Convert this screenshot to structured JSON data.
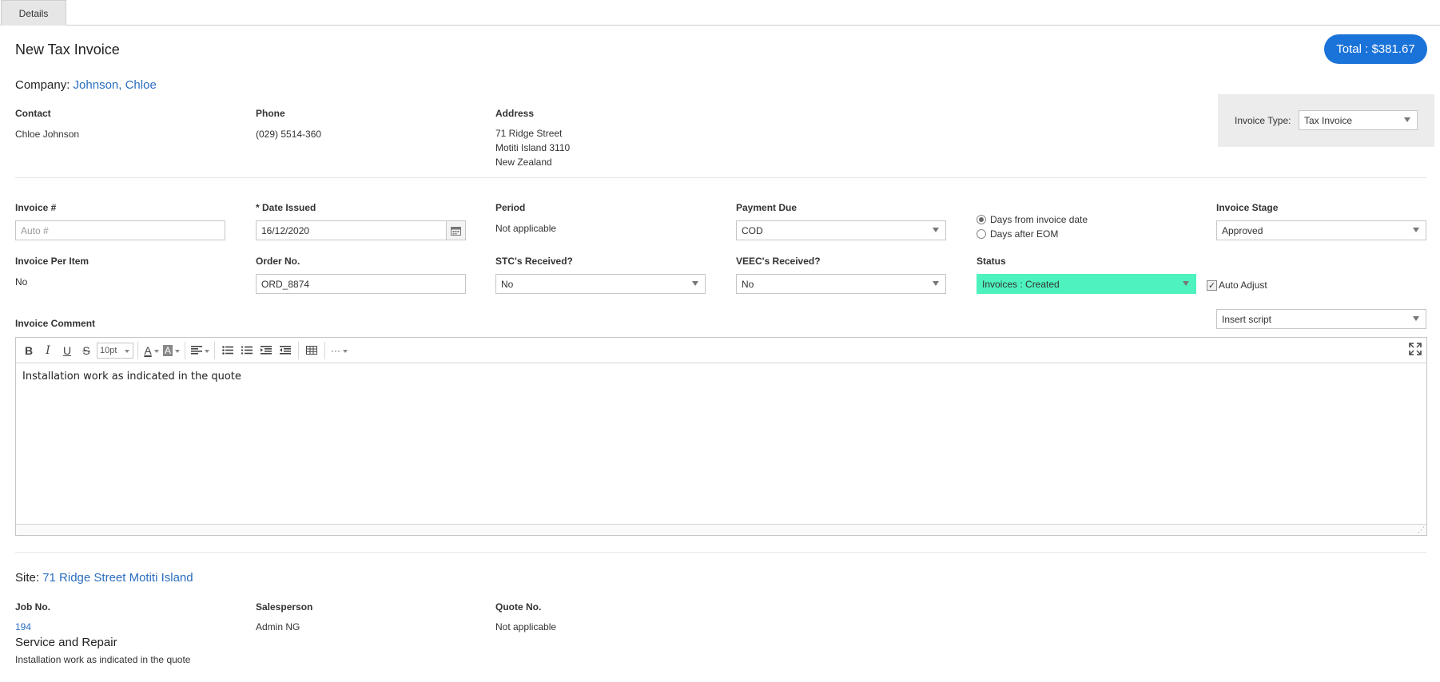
{
  "tabs": [
    {
      "label": "Details"
    }
  ],
  "header": {
    "title": "New Tax Invoice",
    "total_label": "Total : $381.67"
  },
  "company": {
    "label": "Company:",
    "name": "Johnson, Chloe"
  },
  "contact": {
    "label": "Contact",
    "value": "Chloe Johnson"
  },
  "phone": {
    "label": "Phone",
    "value": "(029) 5514-360"
  },
  "address": {
    "label": "Address",
    "lines": [
      "71 Ridge Street",
      "Motiti Island 3110",
      "New Zealand"
    ]
  },
  "invoice_type": {
    "label": "Invoice Type:",
    "value": "Tax Invoice"
  },
  "invoice_no": {
    "label": "Invoice #",
    "placeholder": "Auto #"
  },
  "date_issued": {
    "label": "* Date Issued",
    "value": "16/12/2020"
  },
  "period": {
    "label": "Period",
    "value": "Not applicable"
  },
  "payment_due": {
    "label": "Payment Due",
    "value": "COD"
  },
  "payment_options": [
    {
      "label": "Days from invoice date",
      "selected": true
    },
    {
      "label": "Days after EOM",
      "selected": false
    }
  ],
  "invoice_stage": {
    "label": "Invoice Stage",
    "value": "Approved"
  },
  "invoice_per_item": {
    "label": "Invoice Per Item",
    "value": "No"
  },
  "order_no": {
    "label": "Order No.",
    "value": "ORD_8874"
  },
  "stc_received": {
    "label": "STC's Received?",
    "value": "No"
  },
  "veec_received": {
    "label": "VEEC's Received?",
    "value": "No"
  },
  "status": {
    "label": "Status",
    "value": "Invoices : Created",
    "color": "#4ef2be"
  },
  "auto_adjust": {
    "label": "Auto Adjust",
    "checked": true
  },
  "invoice_comment": {
    "label": "Invoice Comment",
    "insert_script": "Insert script",
    "font_size": "10pt",
    "body": "Installation work as indicated in the quote"
  },
  "site": {
    "label": "Site:",
    "name": "71 Ridge Street Motiti Island"
  },
  "job_no": {
    "label": "Job No.",
    "value": "194"
  },
  "salesperson": {
    "label": "Salesperson",
    "value": "Admin NG"
  },
  "quote_no": {
    "label": "Quote No.",
    "value": "Not applicable"
  },
  "job": {
    "title": "Service and Repair",
    "description": "Installation work as indicated in the quote"
  },
  "colors": {
    "accent": "#1a73d9",
    "link": "#2a6ebf"
  }
}
